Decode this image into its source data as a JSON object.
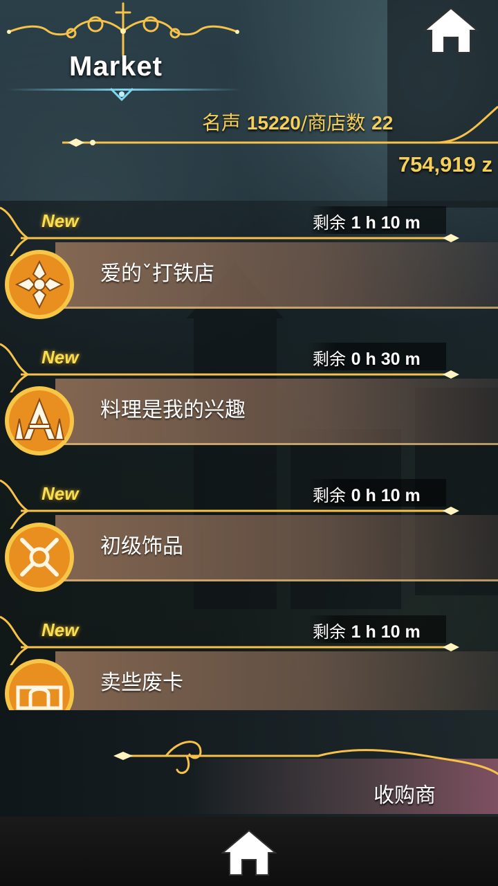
{
  "header": {
    "title": "Market",
    "home_icon": "home-icon"
  },
  "stats": {
    "fame_label": "名声",
    "fame_value": "15220",
    "shops_label": "/商店数",
    "shops_value": "22"
  },
  "money": "754,919 z",
  "shops": [
    {
      "new_label": "New",
      "remaining_label": "剩余",
      "remaining_value": "1 h 10 m",
      "name": "爱的ˇ打铁店",
      "icon": "blacksmith-emblem-icon"
    },
    {
      "new_label": "New",
      "remaining_label": "剩余",
      "remaining_value": "0 h 30 m",
      "name": "料理是我的兴趣",
      "icon": "cooking-emblem-icon"
    },
    {
      "new_label": "New",
      "remaining_label": "剩余",
      "remaining_value": "0 h 10 m",
      "name": "初级饰品",
      "icon": "accessory-emblem-icon"
    },
    {
      "new_label": "New",
      "remaining_label": "剩余",
      "remaining_value": "1 h 10 m",
      "name": "卖些废卡",
      "icon": "card-emblem-icon"
    }
  ],
  "buyer": {
    "label": "收购商"
  },
  "colors": {
    "gold": "#f4cf5a",
    "new_yellow": "#f7de55",
    "emblem_orange": "#f2a22a"
  }
}
